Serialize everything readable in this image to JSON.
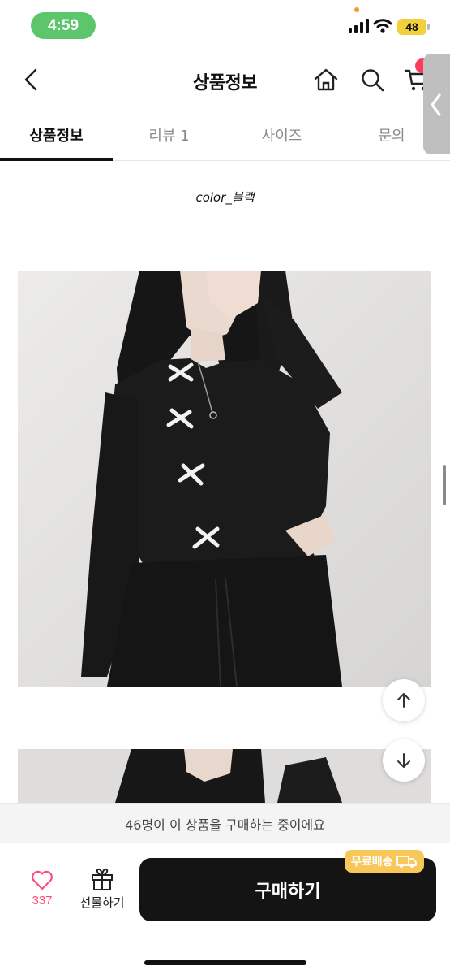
{
  "status_bar": {
    "time": "4:59",
    "battery": "48"
  },
  "header": {
    "title": "상품정보"
  },
  "tabs": [
    {
      "label": "상품정보",
      "active": true
    },
    {
      "label": "리뷰 1",
      "active": false
    },
    {
      "label": "사이즈",
      "active": false
    },
    {
      "label": "문의",
      "active": false
    }
  ],
  "content": {
    "color_caption": "color_블랙"
  },
  "notice": {
    "text": "46명이 이 상품을 구매하는 중이에요"
  },
  "bottom": {
    "like_count": "337",
    "gift_label": "선물하기",
    "buy_label": "구매하기",
    "free_shipping_label": "무료배송"
  },
  "colors": {
    "accent_pink": "#ff4d7d",
    "buy_button": "#141414",
    "shipping_badge": "#f7c75a",
    "time_pill": "#5dc66d"
  }
}
